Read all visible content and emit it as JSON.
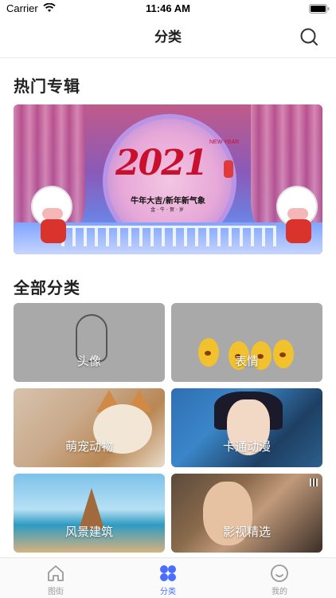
{
  "status_bar": {
    "carrier": "Carrier",
    "time": "11:46 AM",
    "wifi_icon": "wifi-icon",
    "battery_icon": "battery-icon"
  },
  "nav": {
    "title": "分类",
    "search_icon": "search-icon"
  },
  "sections": {
    "hot_album_title": "热门专辑",
    "all_categories_title": "全部分类"
  },
  "banner": {
    "main_text": "牛年大吉/新年新气象",
    "sub_text": "金·牛·贺·岁",
    "art_text": "2021",
    "new_year": "NEW YEAR"
  },
  "categories": [
    {
      "label": "头像"
    },
    {
      "label": "表情"
    },
    {
      "label": "萌宠动物"
    },
    {
      "label": "卡通动漫"
    },
    {
      "label": "风景建筑"
    },
    {
      "label": "影视精选"
    }
  ],
  "tab_bar": {
    "items": [
      {
        "label": "图街",
        "icon": "home-icon",
        "active": false
      },
      {
        "label": "分类",
        "icon": "grid-icon",
        "active": true
      },
      {
        "label": "我的",
        "icon": "profile-icon",
        "active": false
      }
    ],
    "active_color": "#4a6fff",
    "inactive_color": "#9a9a9a"
  }
}
